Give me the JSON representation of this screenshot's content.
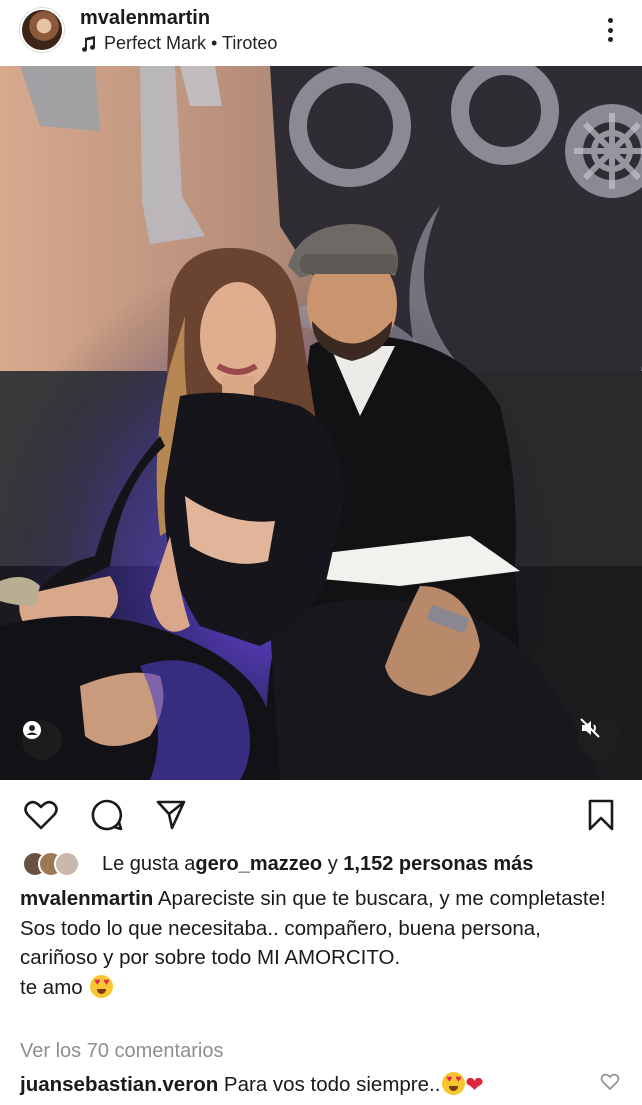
{
  "post": {
    "username": "mvalenmartin",
    "music": "Perfect Mark • Tiroteo"
  },
  "icons": {
    "more": "more-vertical-icon",
    "music": "music-note-icon",
    "user_tag": "user-tag-icon",
    "mute": "speaker-muted-icon",
    "like": "heart-outline-icon",
    "comment": "comment-icon",
    "share": "send-icon",
    "save": "bookmark-icon"
  },
  "likes": {
    "prefix": "Le gusta a ",
    "user": "gero_mazzeo",
    "middle": " y ",
    "count": "1,152 personas más"
  },
  "caption": {
    "user": "mvalenmartin",
    "line1": " Apareciste sin que te buscara, y me completaste!",
    "line2": "Sos todo lo que necesitaba.. compañero, buena persona, cariñoso y por sobre todo MI AMORCITO.",
    "line3": "te amo "
  },
  "comments": {
    "view_all": "Ver los 70 comentarios",
    "items": [
      {
        "user": "juansebastian.veron",
        "text": " Para vos todo siempre.."
      }
    ]
  },
  "colors": {
    "text": "#1a1a1a",
    "muted": "#8e8e8e",
    "heart": "#e0243a"
  }
}
